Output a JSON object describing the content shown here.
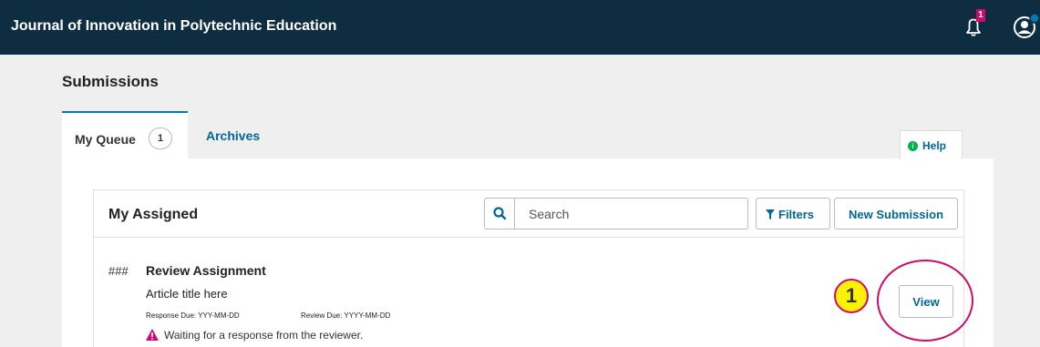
{
  "header": {
    "journal_title": "Journal of Innovation in Polytechnic Education",
    "notification_count": "1",
    "bg_color": "#0f2d40"
  },
  "page": {
    "title": "Submissions"
  },
  "tabs": {
    "queue_label": "My Queue",
    "queue_count": "1",
    "archives_label": "Archives",
    "active": "My Queue"
  },
  "help": {
    "icon": "info-icon",
    "label": "Help"
  },
  "list": {
    "title": "My Assigned",
    "search_placeholder": "Search",
    "filters_label": "Filters",
    "new_submission_label": "New Submission"
  },
  "submission": {
    "id": "###",
    "type": "Review Assignment",
    "article_title": "Article title here",
    "response_due": "Response Due: YYY-MM-DD",
    "review_due": "Review Due: YYYY-MM-DD",
    "status": "Waiting for a response from the reviewer.",
    "view_label": "View"
  },
  "annotation": {
    "step": "1",
    "highlight_color": "#d00a6c",
    "marker_color": "#fff200"
  },
  "colors": {
    "accent": "#006798",
    "tab_active": "#007ab2",
    "warning": "#d00a6c",
    "help_icon": "#00b24e"
  }
}
